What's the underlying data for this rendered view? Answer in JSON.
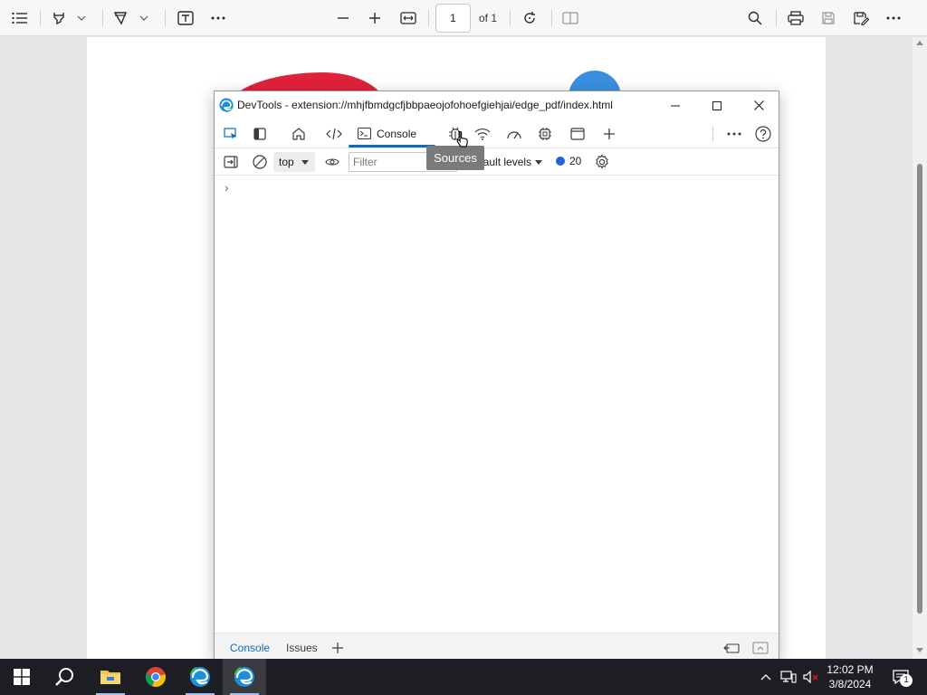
{
  "pdf_toolbar": {
    "page_number": "1",
    "page_total": "of 1"
  },
  "devtools": {
    "title": "DevTools - extension://mhjfbmdgcfjbbpaeojofohoefgiehjai/edge_pdf/index.html",
    "tabs": {
      "console_label": "Console"
    },
    "console_toolbar": {
      "context": "top",
      "filter_placeholder": "Filter",
      "levels": "Default levels",
      "message_count": "20"
    },
    "tooltip": "Sources",
    "prompt": "›",
    "drawer": {
      "tabs": [
        "Console",
        "Issues"
      ]
    }
  },
  "taskbar": {
    "time": "12:02 PM",
    "date": "3/8/2024",
    "notification_count": "1"
  },
  "colors": {
    "accent": "#0f6cbd",
    "taskbar": "#1e1f24"
  },
  "icons": [
    "list-icon",
    "highlighter-icon",
    "draw-icon",
    "text-box-icon",
    "more-icon",
    "zoom-out-icon",
    "zoom-in-icon",
    "fit-width-icon",
    "rotate-icon",
    "two-page-icon",
    "search-icon",
    "print-icon",
    "save-icon",
    "save-as-icon"
  ]
}
